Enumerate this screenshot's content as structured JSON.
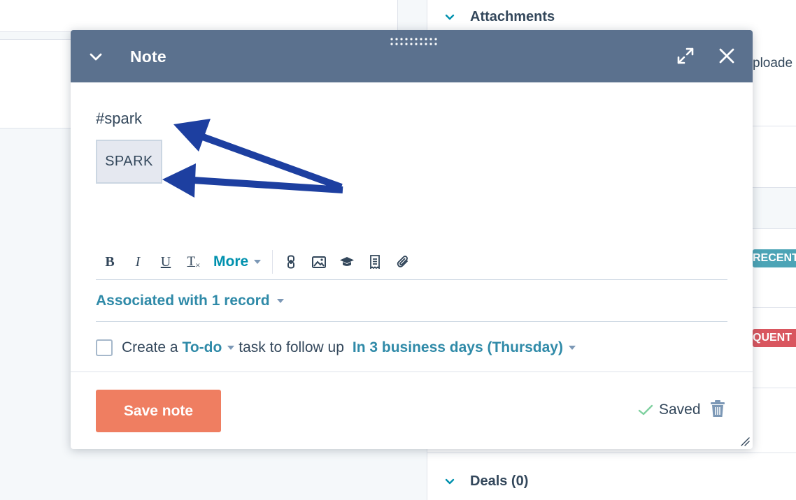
{
  "background": {
    "right_panel": {
      "attachments_header": "Attachments",
      "uploaded_text": "ploade",
      "recent_tag": "RECENT",
      "frequent_tag": "QUENT",
      "deals_header": "Deals (0)"
    }
  },
  "modal": {
    "title": "Note",
    "editor": {
      "text": "#spark",
      "chip": "SPARK"
    },
    "toolbar": {
      "bold": "B",
      "italic": "I",
      "underline": "U",
      "clear_format": "T",
      "more": "More"
    },
    "associations": {
      "label": "Associated with 1 record"
    },
    "followup": {
      "prefix": "Create a",
      "task_type": "To-do",
      "middle": "task to follow up",
      "due": "In 3 business days (Thursday)"
    },
    "footer": {
      "save_label": "Save note",
      "status": "Saved"
    }
  },
  "colors": {
    "header": "#5b718e",
    "link": "#2f8aa8",
    "save_button": "#ef7e61",
    "annotation_arrow": "#1d3fa0",
    "check": "#7fd1a0"
  }
}
